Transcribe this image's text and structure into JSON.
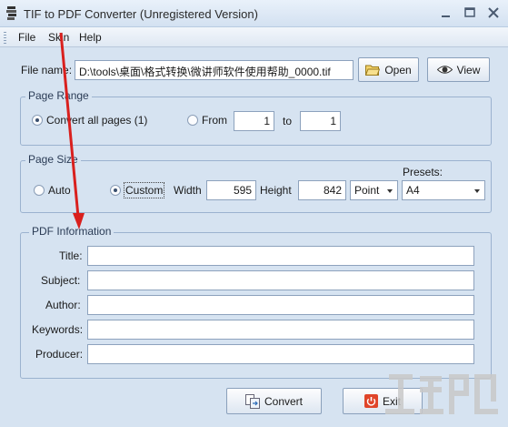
{
  "window": {
    "title": "TIF to PDF Converter (Unregistered Version)"
  },
  "menu": {
    "file": "File",
    "skin": "Skin",
    "help": "Help"
  },
  "file_row": {
    "label": "File name:",
    "value": "D:\\tools\\桌面\\格式转换\\微讲师软件使用帮助_0000.tif",
    "open_button": "Open",
    "view_button": "View"
  },
  "page_range": {
    "legend": "Page Range",
    "convert_all_label": "Convert all pages (1)",
    "convert_all_selected": true,
    "from_label": "From",
    "from_value": "1",
    "to_label": "to",
    "to_value": "1"
  },
  "page_size": {
    "legend": "Page Size",
    "auto_label": "Auto",
    "custom_label": "Custom",
    "custom_selected": true,
    "width_label": "Width",
    "width_value": "595",
    "height_label": "Height",
    "height_value": "842",
    "unit_value": "Point",
    "presets_label": "Presets:",
    "preset_value": "A4"
  },
  "pdf_info": {
    "legend": "PDF Information",
    "fields": [
      {
        "label": "Title:",
        "value": ""
      },
      {
        "label": "Subject:",
        "value": ""
      },
      {
        "label": "Author:",
        "value": ""
      },
      {
        "label": "Keywords:",
        "value": ""
      },
      {
        "label": "Producer:",
        "value": ""
      }
    ]
  },
  "actions": {
    "convert": "Convert",
    "exit": "Exit"
  },
  "colors": {
    "window_bg": "#d6e3f1",
    "group_border": "#9bb2cf",
    "annotation_arrow": "#d9201e",
    "exit_icon": "#e0452a"
  }
}
